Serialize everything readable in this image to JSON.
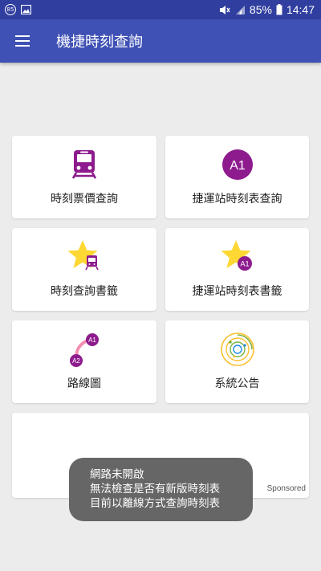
{
  "status_bar": {
    "badge": "85",
    "battery_percent": "85%",
    "time": "14:47"
  },
  "app_bar": {
    "title": "機捷時刻查詢"
  },
  "menu": [
    {
      "label": "時刻票價查詢",
      "icon": "train-icon"
    },
    {
      "label": "捷運站時刻表查詢",
      "icon": "a1-station-icon",
      "icon_text": "A1"
    },
    {
      "label": "時刻查詢書籤",
      "icon": "star-train-icon"
    },
    {
      "label": "捷運站時刻表書籤",
      "icon": "star-a1-icon",
      "icon_text": "A1"
    },
    {
      "label": "路線圖",
      "icon": "route-map-icon",
      "icon_text_1": "A1",
      "icon_text_2": "A2"
    },
    {
      "label": "系統公告",
      "icon": "announcement-icon"
    }
  ],
  "ad": {
    "sponsored_label": "Sponsored"
  },
  "toast": {
    "lines": [
      "網路未開啟",
      "無法檢查是否有新版時刻表",
      "目前以離線方式查詢時刻表"
    ]
  },
  "colors": {
    "status_bar": "#303f9f",
    "app_bar": "#3f51b5",
    "accent_purple": "#8e1b8e",
    "star_yellow": "#fdd835",
    "route_pink": "#f48fb1",
    "background": "#ececec"
  }
}
